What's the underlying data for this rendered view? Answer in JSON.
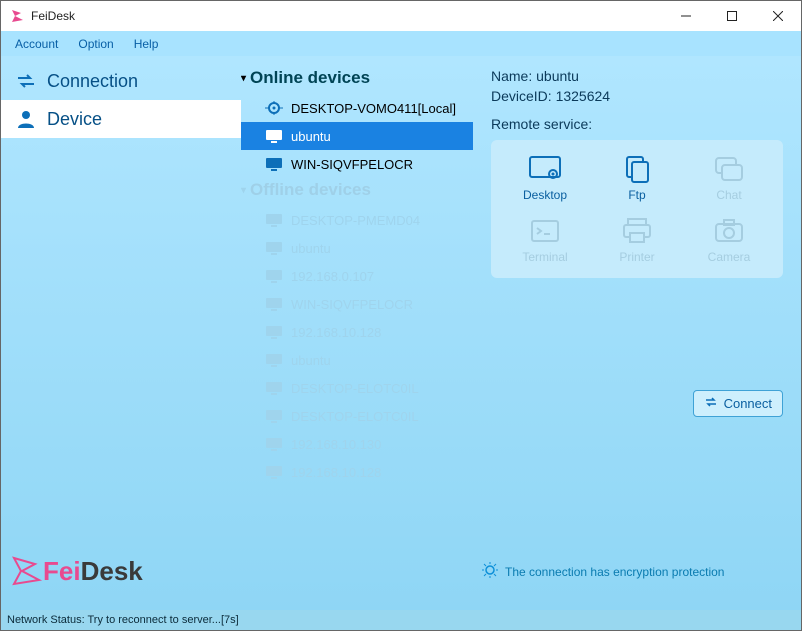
{
  "window": {
    "title": "FeiDesk"
  },
  "menubar": {
    "account": "Account",
    "option": "Option",
    "help": "Help"
  },
  "left_nav": {
    "connection": "Connection",
    "device": "Device"
  },
  "brand": {
    "fei": "Fei",
    "desk": "Desk"
  },
  "center": {
    "online_header": "Online devices",
    "offline_header": "Offline devices",
    "online": [
      {
        "label": "DESKTOP-VOMO411[Local]",
        "icon": "target"
      },
      {
        "label": "ubuntu",
        "icon": "monitor",
        "selected": true
      },
      {
        "label": "WIN-SIQVFPELOCR",
        "icon": "monitor"
      }
    ],
    "offline": [
      "DESKTOP-PMEMD04",
      "ubuntu",
      "192.168.0.107",
      "WIN-SIQVFPELOCR",
      "192.168.10.128",
      "ubuntu",
      "DESKTOP-ELOTC0IL",
      "DESKTOP-ELOTC0IL",
      "192.168.10.130",
      "192.168.10.128"
    ]
  },
  "details": {
    "name_label": "Name:",
    "name_value": "ubuntu",
    "id_label": "DeviceID:",
    "id_value": "1325624",
    "remote_service_label": "Remote service:",
    "services": {
      "desktop": "Desktop",
      "ftp": "Ftp",
      "chat": "Chat",
      "terminal": "Terminal",
      "printer": "Printer",
      "camera": "Camera"
    },
    "connect": "Connect",
    "encryption_note": "The connection has encryption protection"
  },
  "statusbar": {
    "text": "Network Status: Try to reconnect to server...[7s]"
  }
}
